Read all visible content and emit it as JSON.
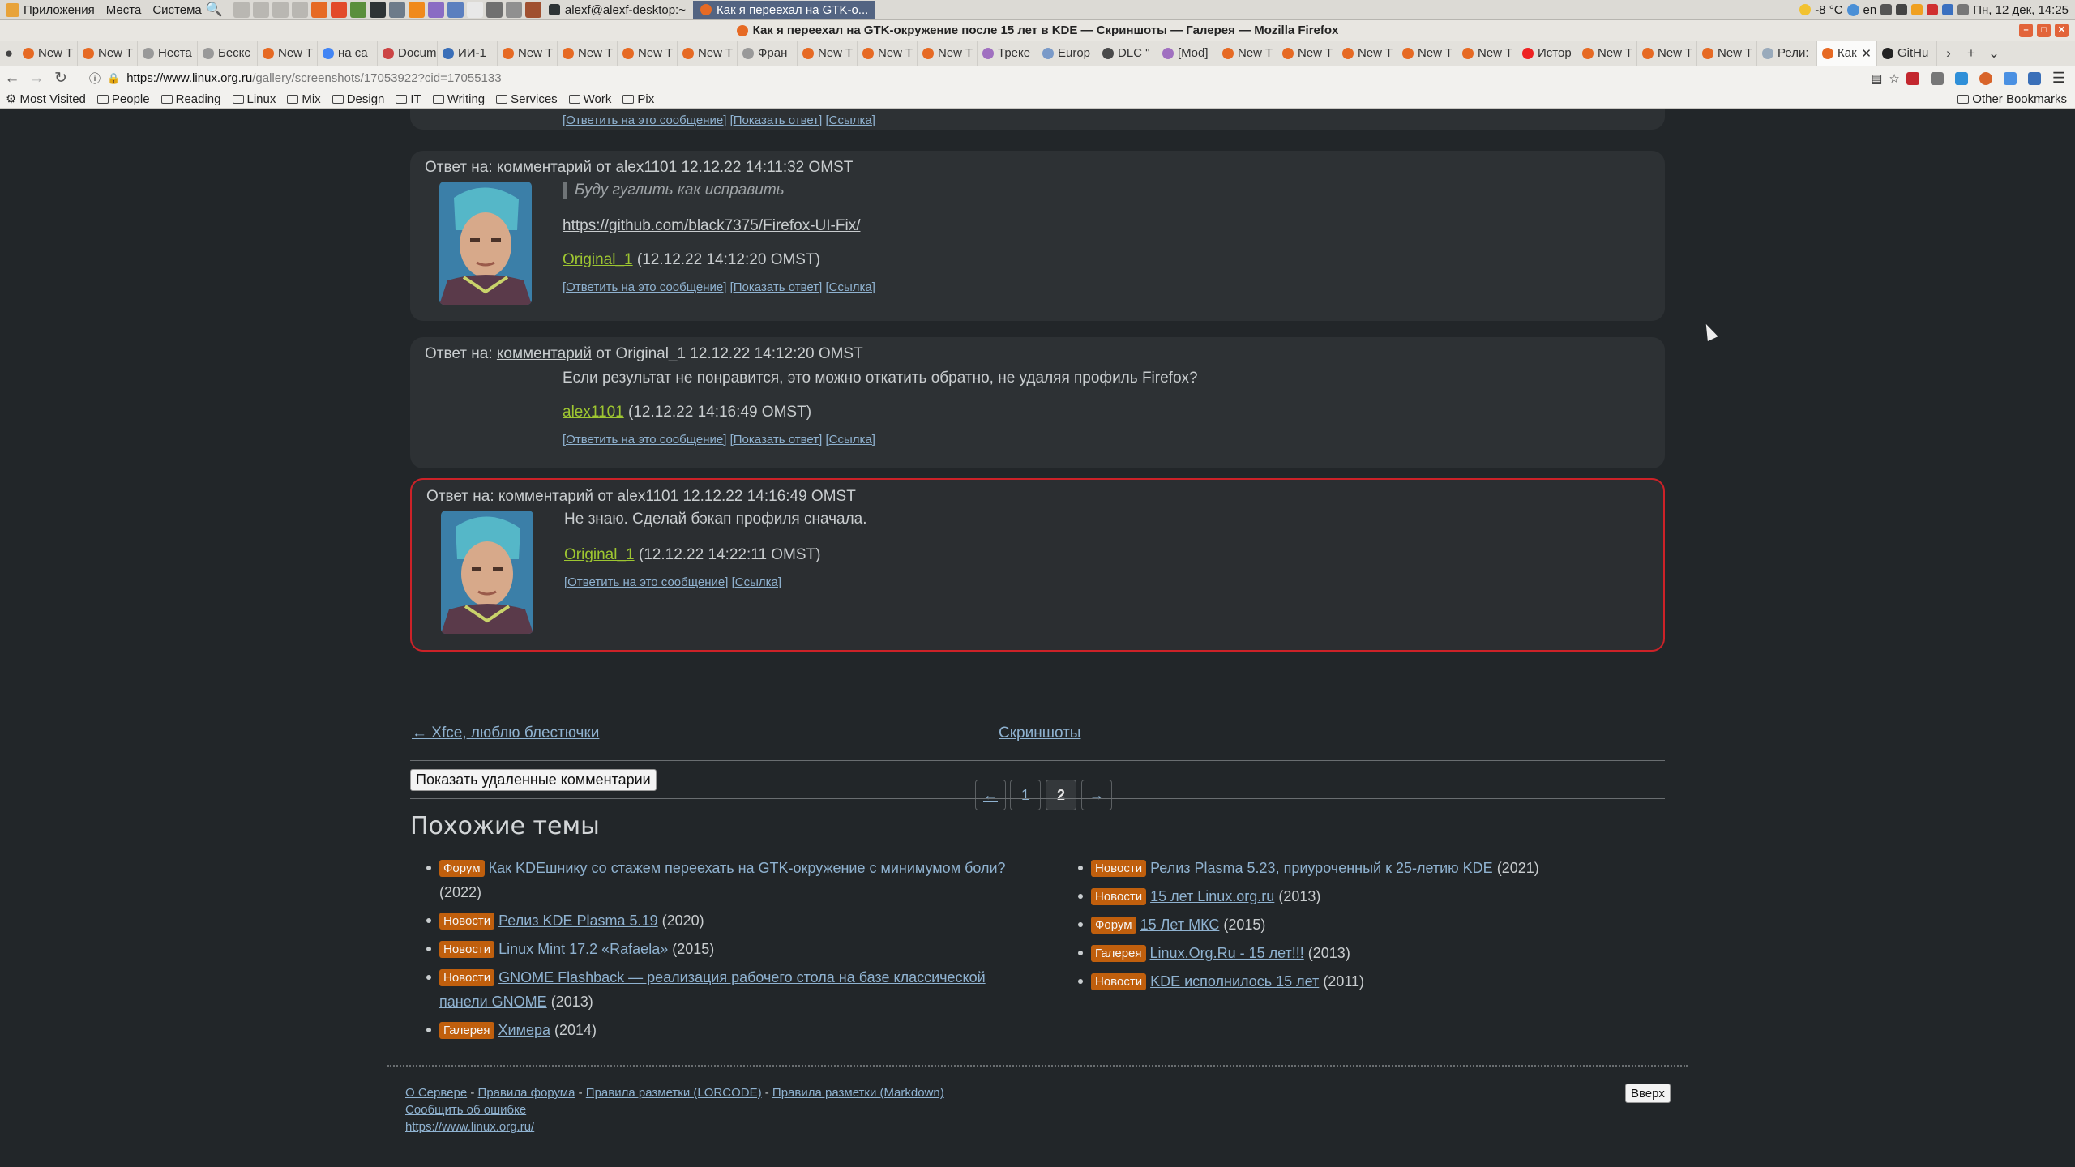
{
  "panel": {
    "menus": [
      "Приложения",
      "Места",
      "Система"
    ],
    "tasks": [
      "alexf@alexf-desktop:~",
      "Как я переехал на GTK-о..."
    ],
    "tray": {
      "temp": "-8 °C",
      "lang": "en",
      "clock": "Пн, 12 дек, 14:25"
    }
  },
  "window": {
    "title": "Как я переехал на GTK-окружение после 15 лет в KDE — Скриншоты — Галерея — Mozilla Firefox"
  },
  "tabs": [
    "New T",
    "New T",
    "Неста",
    "Бескс",
    "New T",
    "на са",
    "Docum",
    "ИИ-1",
    "New T",
    "New T",
    "New T",
    "New T",
    "Фран",
    "New T",
    "New T",
    "New T",
    "Треке",
    "Europ",
    "DLC \"",
    "[Mod]",
    "New T",
    "New T",
    "New T",
    "New T",
    "New T",
    "Истор",
    "New T",
    "New T",
    "New T",
    "Рели:",
    "Как",
    "GitHu"
  ],
  "nav": {
    "url_host": "https://www.linux.org.ru",
    "url_path": "/gallery/screenshots/17053922?cid=17055133"
  },
  "bookmarks": [
    "Most Visited",
    "People",
    "Reading",
    "Linux",
    "Mix",
    "Design",
    "IT",
    "Writing",
    "Services",
    "Work",
    "Pix"
  ],
  "other_bookmarks": "Other Bookmarks",
  "top_links": {
    "reply": "[Ответить на это сообщение]",
    "show": "[Показать ответ]",
    "link": "[Ссылка]"
  },
  "comments": [
    {
      "head_prefix": "Ответ на:",
      "head_link": "комментарий",
      "head_suffix": "от alex1101 12.12.22 14:11:32 OMST",
      "quote": "Буду гуглить как исправить",
      "text_link": "https://github.com/black7375/Firefox-UI-Fix/",
      "author": "Original_1",
      "date": "(12.12.22 14:12:20 OMST)",
      "reply": "[Ответить на это сообщение]",
      "show": "[Показать ответ]",
      "link": "[Ссылка]"
    },
    {
      "head_prefix": "Ответ на:",
      "head_link": "комментарий",
      "head_suffix": "от Original_1 12.12.22 14:12:20 OMST",
      "text": "Если результат не понравится, это можно откатить обратно, не удаляя профиль Firefox?",
      "author": "alex1101",
      "date": "(12.12.22 14:16:49 OMST)",
      "reply": "[Ответить на это сообщение]",
      "show": "[Показать ответ]",
      "link": "[Ссылка]"
    },
    {
      "head_prefix": "Ответ на:",
      "head_link": "комментарий",
      "head_suffix": "от alex1101 12.12.22 14:16:49 OMST",
      "text": "Не знаю. Сделай бэкап профиля сначала.",
      "author": "Original_1",
      "date": "(12.12.22 14:22:11 OMST)",
      "reply": "[Ответить на это сообщение]",
      "link": "[Ссылка]"
    }
  ],
  "pager": {
    "prev": "←",
    "p1": "1",
    "p2": "2",
    "next": "→"
  },
  "prevnext": {
    "prev": "← Xfce, люблю блестючки",
    "section": "Скриншоты"
  },
  "show_deleted": "Показать удаленные комментарии",
  "related_title": "Похожие темы",
  "related_left": [
    {
      "tag": "Форум",
      "title": "Как KDEшнику со стажем переехать на GTK-окружение с минимумом боли?",
      "year": "(2022)"
    },
    {
      "tag": "Новости",
      "title": "Релиз KDE Plasma 5.19",
      "year": "(2020)"
    },
    {
      "tag": "Новости",
      "title": "Linux Mint 17.2 «Rafaela»",
      "year": "(2015)"
    },
    {
      "tag": "Новости",
      "title": "GNOME Flashback — реализация рабочего стола на базе классической панели GNOME",
      "year": "(2013)"
    },
    {
      "tag": "Галерея",
      "title": "Химера",
      "year": "(2014)"
    }
  ],
  "related_right": [
    {
      "tag": "Новости",
      "title": "Релиз Plasma 5.23, приуроченный к 25-летию KDE",
      "year": "(2021)"
    },
    {
      "tag": "Новости",
      "title": "15 лет Linux.org.ru",
      "year": "(2013)"
    },
    {
      "tag": "Форум",
      "title": "15 Лет МКС",
      "year": "(2015)"
    },
    {
      "tag": "Галерея",
      "title": "Linux.Org.Ru - 15 лет!!!",
      "year": "(2013)"
    },
    {
      "tag": "Новости",
      "title": "KDE исполнилось 15 лет",
      "year": "(2011)"
    }
  ],
  "footer": {
    "about": "О Сервере",
    "rules": "Правила форума",
    "lorcode": "Правила разметки (LORCODE)",
    "markdown": "Правила разметки (Markdown)",
    "report": "Сообщить об ошибке",
    "site": "https://www.linux.org.ru/",
    "up": "Вверх",
    "sep": "-"
  },
  "colors": {
    "page_bg": "#222629",
    "card_bg": "#2d3134",
    "highlight_border": "#cc2228",
    "author": "#9ec631",
    "link": "#8fb2d0",
    "tag_bg": "#c05f0d"
  }
}
